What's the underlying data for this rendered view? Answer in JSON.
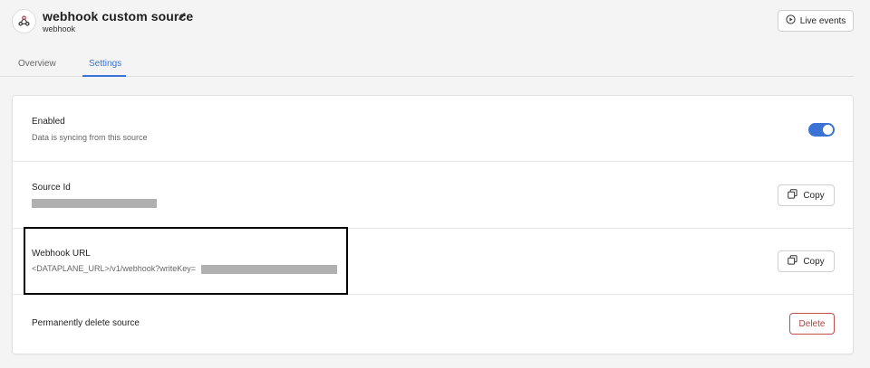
{
  "header": {
    "title": "webhook custom source",
    "subtitle": "webhook",
    "live_events_label": "Live events"
  },
  "tabs": [
    {
      "label": "Overview",
      "active": false
    },
    {
      "label": "Settings",
      "active": true
    }
  ],
  "settings": {
    "enabled": {
      "label": "Enabled",
      "description": "Data is syncing from this source",
      "toggle_on": true
    },
    "source_id": {
      "label": "Source Id",
      "copy_label": "Copy"
    },
    "webhook_url": {
      "label": "Webhook URL",
      "value_prefix": "<DATAPLANE_URL>/v1/webhook?writeKey=",
      "copy_label": "Copy"
    },
    "delete": {
      "label": "Permanently delete source",
      "button_label": "Delete"
    }
  },
  "colors": {
    "accent": "#3a72d6",
    "danger": "#b3403b",
    "background": "#f4f4f4"
  },
  "icons": {
    "source": "webhook-icon",
    "edit": "pencil-icon",
    "live": "play-circle-icon",
    "copy": "copy-icon"
  }
}
